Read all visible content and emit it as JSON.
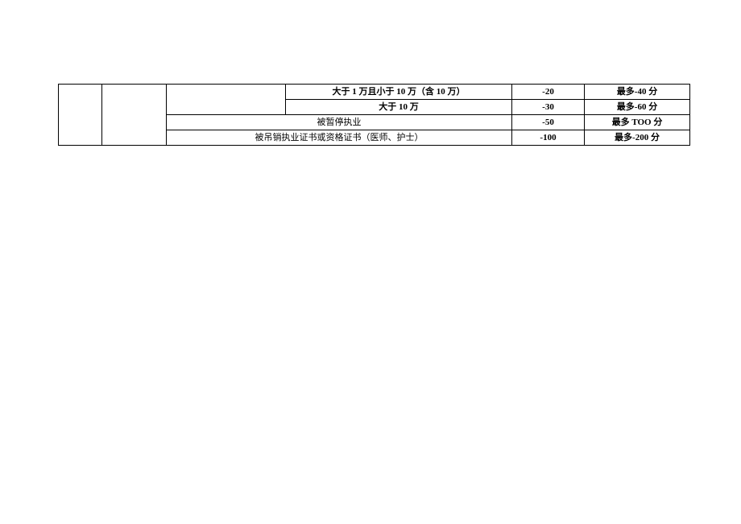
{
  "table": {
    "rows": [
      {
        "desc": "大于 1 万且小于 10 万（含 10 万）",
        "score": "-20",
        "max": "最多-40 分"
      },
      {
        "desc": "大于 10 万",
        "score": "-30",
        "max": "最多-60 分"
      },
      {
        "desc": "被暂停执业",
        "score": "-50",
        "max": "最多 TOO 分"
      },
      {
        "desc": "被吊销执业证书或资格证书（医师、护士）",
        "score": "-100",
        "max": "最多-200 分"
      }
    ]
  }
}
